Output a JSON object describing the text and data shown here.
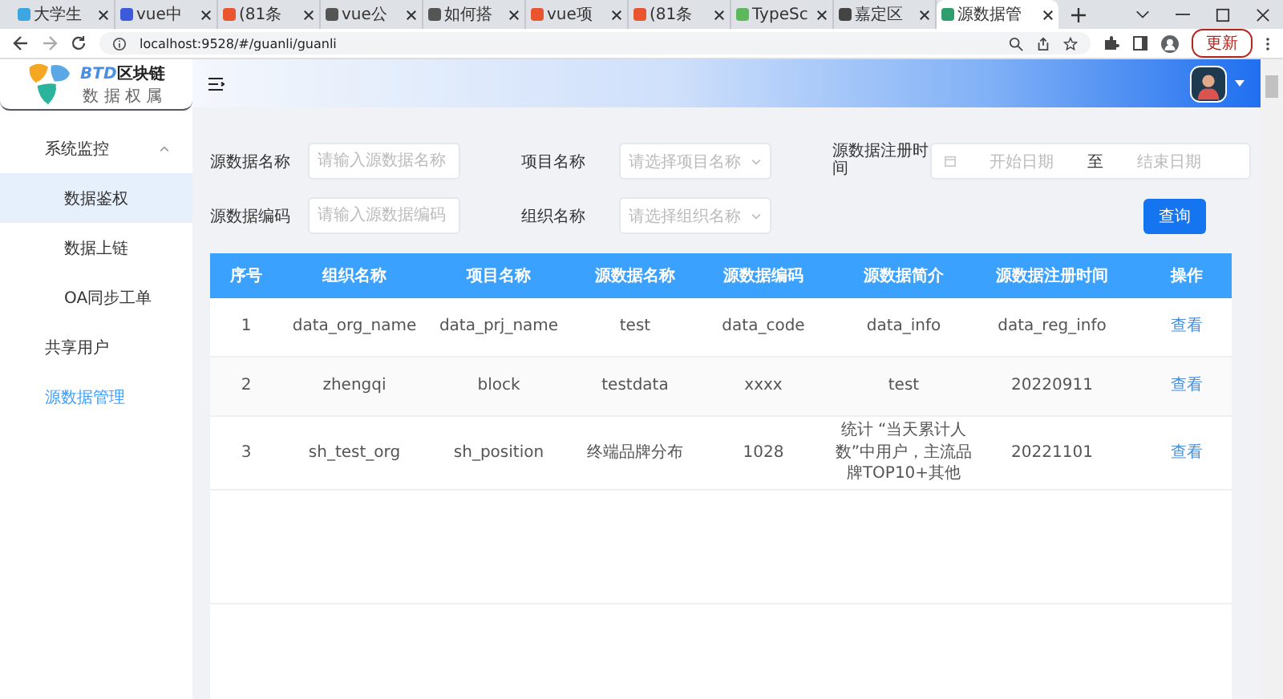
{
  "browser": {
    "tabs": [
      {
        "title": "大学生",
        "selected": false
      },
      {
        "title": "vue中",
        "selected": false
      },
      {
        "title": "(81条",
        "selected": false
      },
      {
        "title": "vue公",
        "selected": false
      },
      {
        "title": "如何搭",
        "selected": false
      },
      {
        "title": "vue项",
        "selected": false
      },
      {
        "title": "(81条",
        "selected": false
      },
      {
        "title": "TypeSc",
        "selected": false
      },
      {
        "title": "嘉定区",
        "selected": false
      },
      {
        "title": "源数据管",
        "selected": true
      }
    ],
    "address": "localhost:9528/#/guanli/guanli",
    "update_button": "更新"
  },
  "logo": {
    "prefix": "BTD",
    "name": "区块链",
    "subtitle": "数 据 权 属"
  },
  "sidebar": {
    "items": [
      {
        "label": "系统监控",
        "selected": false,
        "expanded": true,
        "children": [
          {
            "label": "数据鉴权",
            "selected": true
          },
          {
            "label": "数据上链",
            "selected": false
          },
          {
            "label": "OA同步工单",
            "selected": false
          }
        ]
      },
      {
        "label": "共享用户",
        "selected": false
      },
      {
        "label": "源数据管理",
        "selected": false,
        "active": true
      }
    ]
  },
  "filters": {
    "source_name": {
      "label": "源数据名称",
      "placeholder": "请输入源数据名称"
    },
    "project_name": {
      "label": "项目名称",
      "placeholder": "请选择项目名称"
    },
    "register_time": {
      "label": "源数据注册时间",
      "start_placeholder": "开始日期",
      "separator": "至",
      "end_placeholder": "结束日期"
    },
    "source_code": {
      "label": "源数据编码",
      "placeholder": "请输入源数据编码"
    },
    "org_name": {
      "label": "组织名称",
      "placeholder": "请选择组织名称"
    },
    "query_button": "查询"
  },
  "table": {
    "columns": [
      "序号",
      "组织名称",
      "项目名称",
      "源数据名称",
      "源数据编码",
      "源数据简介",
      "源数据注册时间",
      "操作"
    ],
    "rows": [
      {
        "cells": [
          "1",
          "data_org_name",
          "data_prj_name",
          "test",
          "data_code",
          "data_info",
          "data_reg_info"
        ],
        "action": "查看"
      },
      {
        "cells": [
          "2",
          "zhengqi",
          "block",
          "testdata",
          "xxxx",
          "test",
          "20220911"
        ],
        "action": "查看"
      },
      {
        "cells": [
          "3",
          "sh_test_org",
          "sh_position",
          "终端品牌分布",
          "1028",
          "统计 “当天累计人数”中用户，主流品牌TOP10+其他",
          "20221101"
        ],
        "action": "查看"
      }
    ]
  }
}
